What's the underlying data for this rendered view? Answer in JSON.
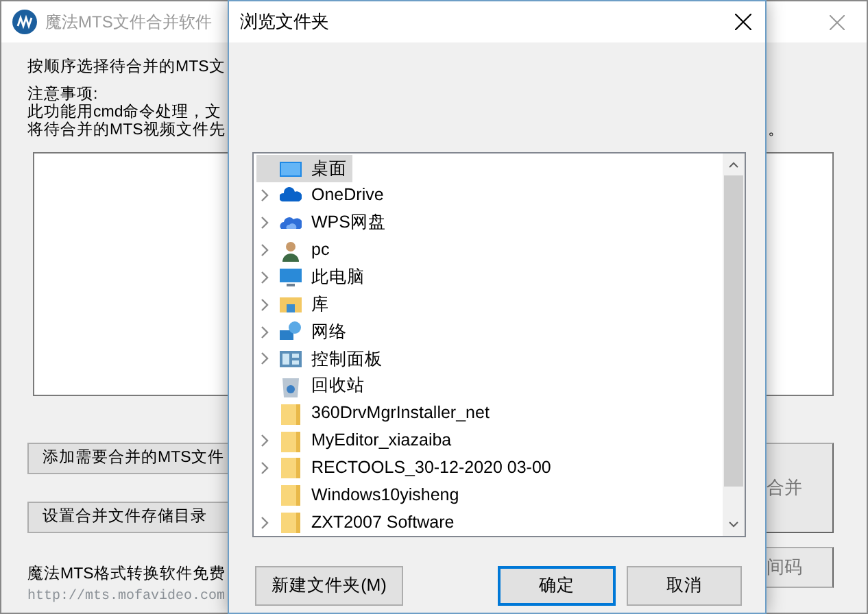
{
  "main_window": {
    "title": "魔法MTS文件合并软件",
    "instruction": "按顺序选择待合并的MTS文",
    "notes_title": "注意事项:",
    "notes": [
      "此功能用cmd命令处理，文",
      "将待合并的MTS视频文件先"
    ],
    "notes_tail": "。",
    "buttons": [
      "添加需要合并的MTS文件",
      "设置合并文件存储目录"
    ],
    "right_buttons": [
      "合并",
      "间码"
    ],
    "footer": "魔法MTS格式转换软件免费",
    "link": "http://mts.mofavideo.com"
  },
  "dialog": {
    "title": "浏览文件夹",
    "tree": [
      {
        "kind": "desktop",
        "label": "桌面",
        "expandable": false,
        "selected": true
      },
      {
        "kind": "cloud",
        "label": "OneDrive",
        "expandable": true,
        "selected": false
      },
      {
        "kind": "cloud2",
        "label": "WPS网盘",
        "expandable": true,
        "selected": false
      },
      {
        "kind": "user",
        "label": "pc",
        "expandable": true,
        "selected": false
      },
      {
        "kind": "computer",
        "label": "此电脑",
        "expandable": true,
        "selected": false
      },
      {
        "kind": "library",
        "label": "库",
        "expandable": true,
        "selected": false
      },
      {
        "kind": "network",
        "label": "网络",
        "expandable": true,
        "selected": false
      },
      {
        "kind": "control",
        "label": "控制面板",
        "expandable": true,
        "selected": false
      },
      {
        "kind": "recycle",
        "label": "回收站",
        "expandable": false,
        "selected": false
      },
      {
        "kind": "folder",
        "label": "360DrvMgrInstaller_net",
        "expandable": false,
        "selected": false
      },
      {
        "kind": "folder",
        "label": "MyEditor_xiazaiba",
        "expandable": true,
        "selected": false
      },
      {
        "kind": "folder",
        "label": "RECTOOLS_30-12-2020 03-00",
        "expandable": true,
        "selected": false
      },
      {
        "kind": "folder",
        "label": "Windows10yisheng",
        "expandable": false,
        "selected": false
      },
      {
        "kind": "folder",
        "label": "ZXT2007 Software",
        "expandable": true,
        "selected": false
      }
    ],
    "buttons": [
      {
        "label": "新建文件夹(M)",
        "default": false
      },
      {
        "label": "确定",
        "default": true
      },
      {
        "label": "取消",
        "default": false
      }
    ]
  }
}
